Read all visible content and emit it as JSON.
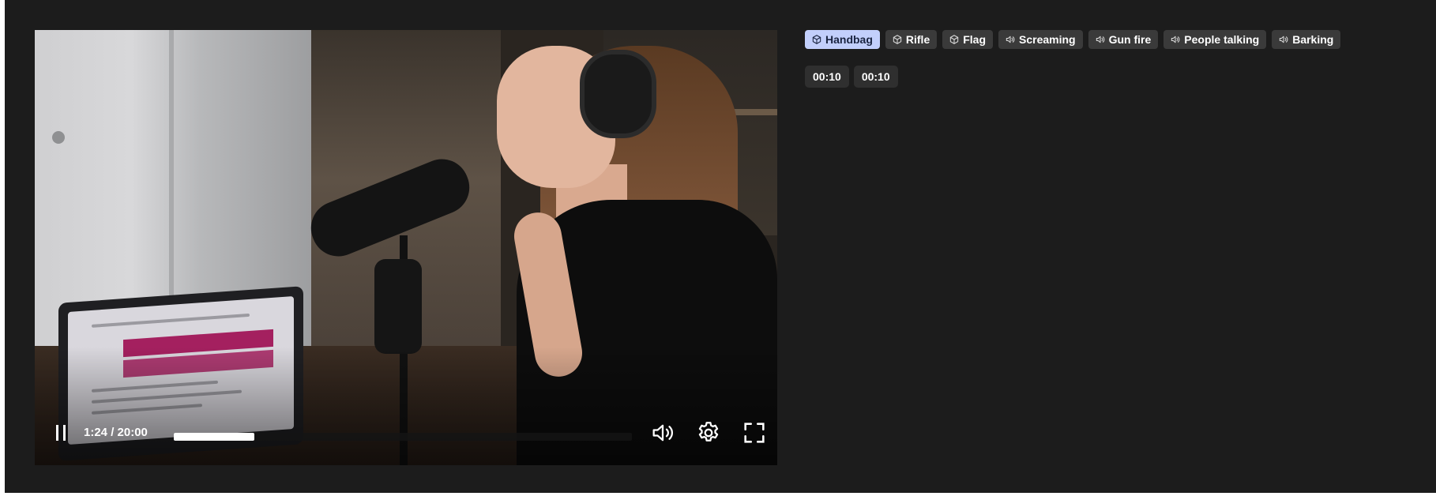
{
  "player": {
    "time_display": "1:24 / 20:00",
    "progress_fraction": 0.07,
    "state": "playing"
  },
  "tags": [
    {
      "label": "Handbag",
      "icon": "cube-icon",
      "active": true
    },
    {
      "label": "Rifle",
      "icon": "cube-icon",
      "active": false
    },
    {
      "label": "Flag",
      "icon": "cube-icon",
      "active": false
    },
    {
      "label": "Screaming",
      "icon": "speaker-icon",
      "active": false
    },
    {
      "label": "Gun fire",
      "icon": "speaker-icon",
      "active": false
    },
    {
      "label": "People talking",
      "icon": "speaker-icon",
      "active": false
    },
    {
      "label": "Barking",
      "icon": "speaker-icon",
      "active": false
    }
  ],
  "timestamps": [
    "00:10",
    "00:10"
  ],
  "colors": {
    "background": "#1c1c1c",
    "tag_bg": "#3a3a3a",
    "tag_active_bg": "#c2cffb",
    "chip_bg": "#2f2f2f",
    "progress_fill": "#ffffff"
  }
}
